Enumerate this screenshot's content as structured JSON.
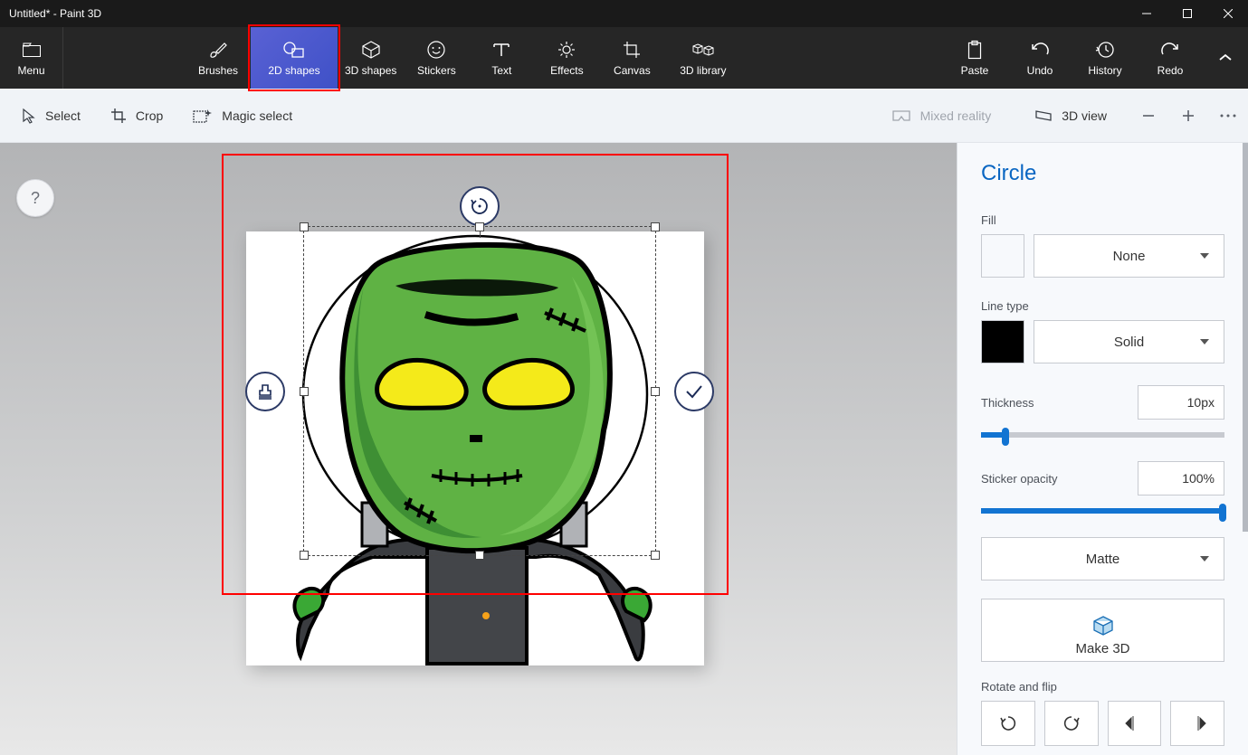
{
  "title": "Untitled* - Paint 3D",
  "window_controls": {
    "min": "minimize",
    "max": "maximize",
    "close": "close"
  },
  "toolbar": {
    "menu": "Menu",
    "brushes": "Brushes",
    "shapes2d": "2D shapes",
    "shapes3d": "3D shapes",
    "stickers": "Stickers",
    "text": "Text",
    "effects": "Effects",
    "canvas": "Canvas",
    "library3d": "3D library",
    "paste": "Paste",
    "undo": "Undo",
    "history": "History",
    "redo": "Redo"
  },
  "subbar": {
    "select": "Select",
    "crop": "Crop",
    "magic": "Magic select",
    "mixed": "Mixed reality",
    "view3d": "3D view"
  },
  "help_glyph": "?",
  "panel": {
    "heading": "Circle",
    "fill_label": "Fill",
    "fill_dropdown": "None",
    "line_label": "Line type",
    "line_dropdown": "Solid",
    "thickness_label": "Thickness",
    "thickness_value": "10px",
    "thickness_percent": 10,
    "opacity_label": "Sticker opacity",
    "opacity_value": "100%",
    "opacity_percent": 100,
    "surface": "Matte",
    "make3d": "Make 3D",
    "rotate_label": "Rotate and flip"
  }
}
